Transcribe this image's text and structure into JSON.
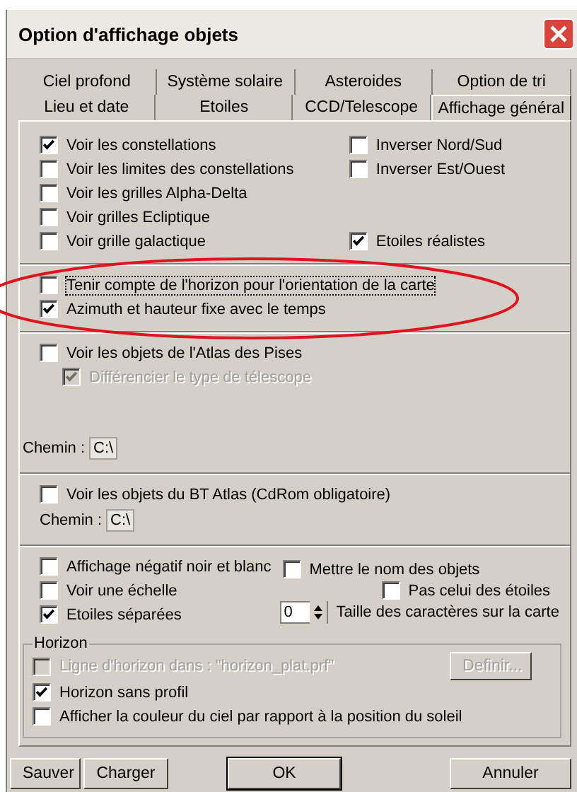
{
  "window": {
    "title": "Option d'affichage objets"
  },
  "tab_rows": [
    {
      "tabs": [
        {
          "label": "Ciel profond",
          "selected": false
        },
        {
          "label": "Système solaire",
          "selected": false
        },
        {
          "label": "Asteroides",
          "selected": false
        },
        {
          "label": "Option de tri",
          "selected": false
        }
      ]
    },
    {
      "tabs": [
        {
          "label": "Lieu et date",
          "selected": false
        },
        {
          "label": "Etoiles",
          "selected": false
        },
        {
          "label": "CCD/Telescope",
          "selected": false
        },
        {
          "label": "Affichage général",
          "selected": true
        }
      ]
    }
  ],
  "grids": {
    "left": [
      {
        "label": "Voir les constellations",
        "checked": true
      },
      {
        "label": "Voir les limites des constellations",
        "checked": false
      },
      {
        "label": "Voir les grilles Alpha-Delta",
        "checked": false
      },
      {
        "label": "Voir grilles Ecliptique",
        "checked": false
      },
      {
        "label": "Voir grille galactique",
        "checked": false
      }
    ],
    "right": [
      {
        "label": "Inverser Nord/Sud",
        "checked": false
      },
      {
        "label": "Inverser Est/Ouest",
        "checked": false
      }
    ],
    "realistic": {
      "label": "Etoiles réalistes",
      "checked": true
    }
  },
  "orientation": [
    {
      "label": "Tenir compte de l'horizon pour l'orientation de la carte",
      "checked": false,
      "focused": true
    },
    {
      "label": "Azimuth et hauteur fixe avec le temps",
      "checked": true,
      "focused": false
    }
  ],
  "pises_atlas": {
    "label": "Voir les objets de l'Atlas des Pises",
    "checked": false,
    "sub": {
      "label": "Différencier le type de télescope",
      "checked": true,
      "disabled": true
    },
    "path_label": "Chemin :",
    "path": "C:\\"
  },
  "bt_atlas": {
    "label": "Voir les objets du BT Atlas (CdRom obligatoire)",
    "checked": false,
    "path_label": "Chemin :",
    "path": "C:\\"
  },
  "misc": {
    "left": [
      {
        "label": "Affichage négatif noir et blanc",
        "checked": false
      },
      {
        "label": "Voir une échelle",
        "checked": false
      },
      {
        "label": "Etoiles séparées",
        "checked": true
      }
    ],
    "names": {
      "label": "Mettre le nom des objets",
      "checked": false
    },
    "not_stars": {
      "label": "Pas celui des étoiles",
      "checked": false
    },
    "font_size": {
      "value": "0",
      "label": "Taille des caractères sur la carte"
    }
  },
  "horizon": {
    "title": "Horizon",
    "line": {
      "label": "Ligne d'horizon dans : \"horizon_plat.prf\"",
      "checked": false,
      "disabled": true,
      "button": "Definir..."
    },
    "items": [
      {
        "label": "Horizon sans profil",
        "checked": true
      },
      {
        "label": "Afficher la couleur du ciel par rapport à la position du soleil",
        "checked": false
      }
    ]
  },
  "buttons": [
    {
      "label": "Sauver",
      "default": false
    },
    {
      "label": "Charger",
      "default": false
    },
    {
      "label": "OK",
      "default": true
    },
    {
      "label": "Annuler",
      "default": false
    }
  ]
}
